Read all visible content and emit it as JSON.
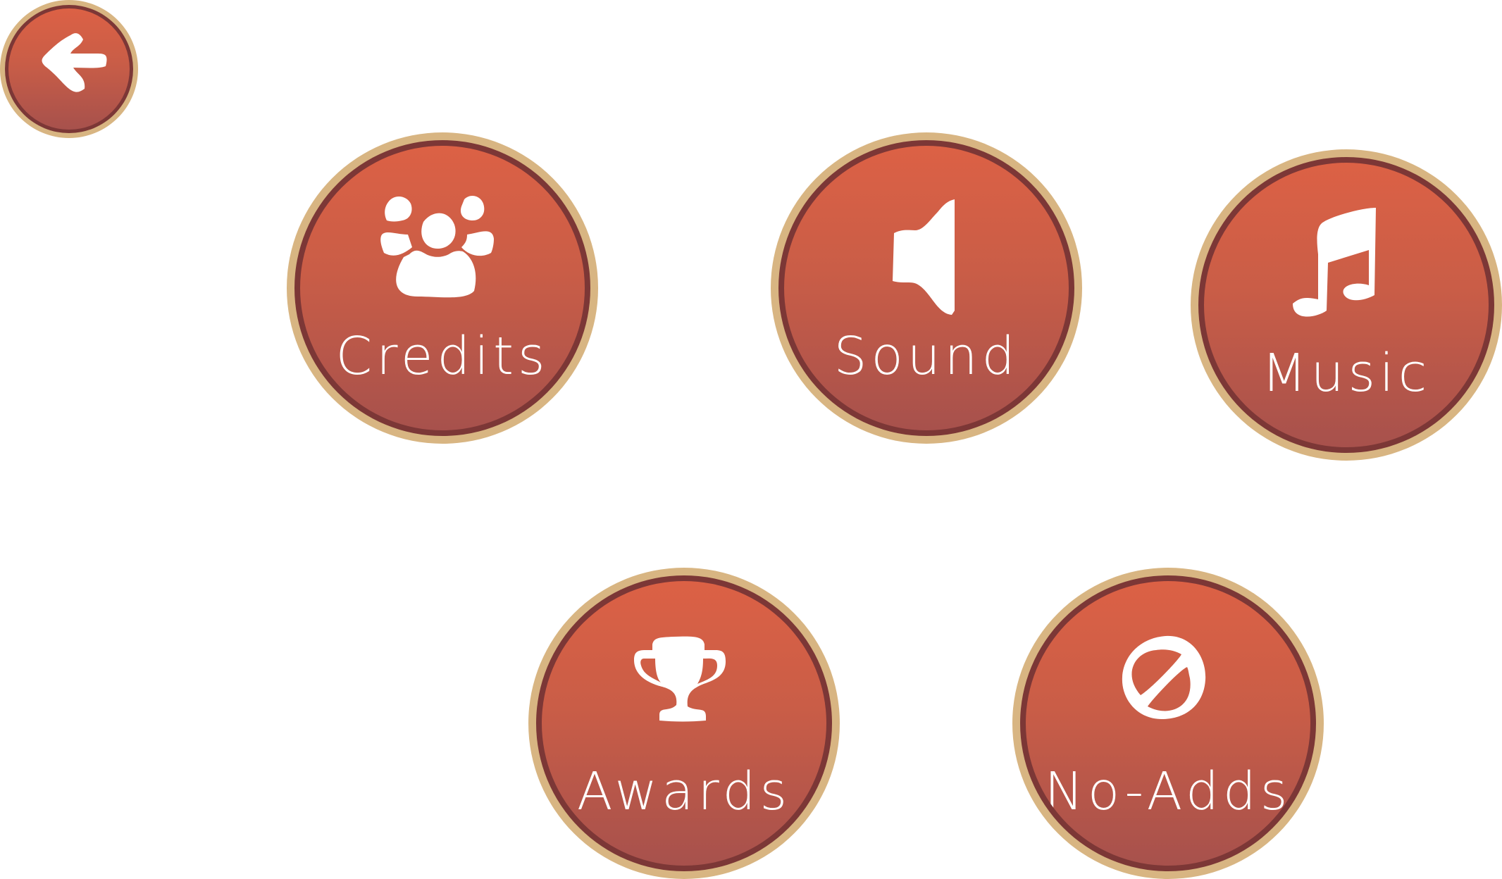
{
  "back_button": {
    "icon": "arrow-left-icon"
  },
  "menu": {
    "credits": {
      "label": "Credits",
      "icon": "people-icon"
    },
    "sound": {
      "label": "Sound",
      "icon": "speaker-icon"
    },
    "music": {
      "label": "Music",
      "icon": "music-note-icon"
    },
    "awards": {
      "label": "Awards",
      "icon": "trophy-icon"
    },
    "no_adds": {
      "label": "No-Adds",
      "icon": "no-sign-icon"
    }
  },
  "colors": {
    "outer_rim": "#d8b582",
    "inner_ring": "#7c3736",
    "face_top": "#dc6145",
    "face_bottom": "#a7514c",
    "text": "#ffffff"
  }
}
